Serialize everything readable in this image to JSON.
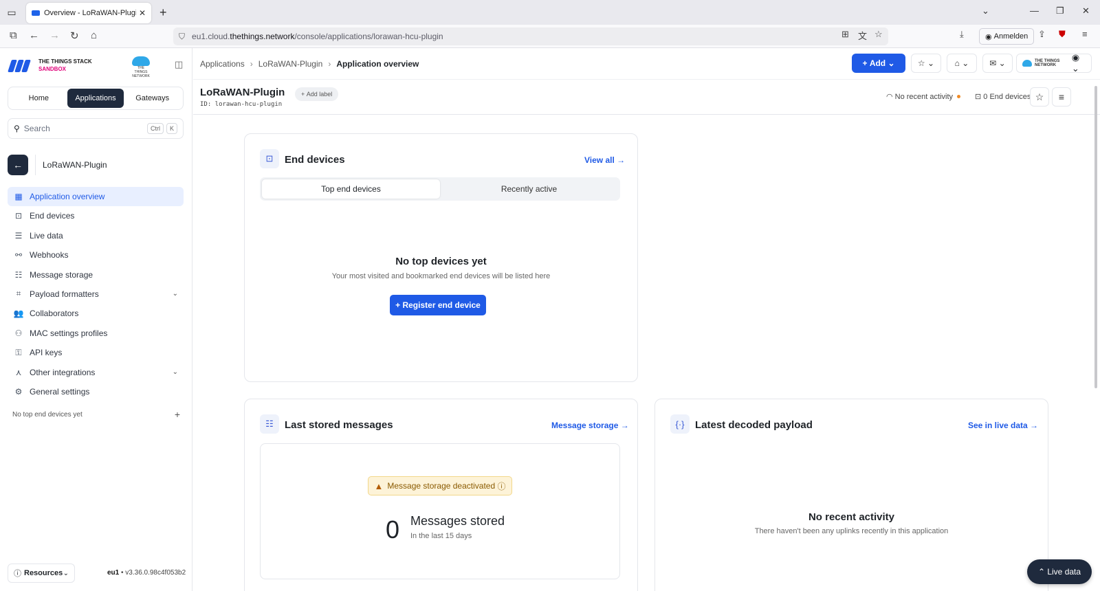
{
  "browser": {
    "tab_title": "Overview - LoRaWAN-Plugin - T",
    "url_prefix": "eu1.cloud.",
    "url_domain": "thethings.network",
    "url_path": "/console/applications/lorawan-hcu-plugin",
    "signin_label": "Anmelden"
  },
  "sidebar": {
    "brand_line1": "THE THINGS STACK",
    "brand_line2": "SANDBOX",
    "ttn_caption": "THE THINGS NETWORK",
    "nav": {
      "home": "Home",
      "applications": "Applications",
      "gateways": "Gateways"
    },
    "search": {
      "placeholder": "Search",
      "key1": "Ctrl",
      "key2": "K"
    },
    "app_name": "LoRaWAN-Plugin",
    "items": [
      {
        "label": "Application overview"
      },
      {
        "label": "End devices"
      },
      {
        "label": "Live data"
      },
      {
        "label": "Webhooks"
      },
      {
        "label": "Message storage"
      },
      {
        "label": "Payload formatters"
      },
      {
        "label": "Collaborators"
      },
      {
        "label": "MAC settings profiles"
      },
      {
        "label": "API keys"
      },
      {
        "label": "Other integrations"
      },
      {
        "label": "General settings"
      }
    ],
    "top_devices": "No top end devices yet",
    "resources_label": "Resources",
    "version_cluster": "eu1",
    "version": " • v3.36.0.98c4f053b2"
  },
  "topbar": {
    "breadcrumbs": [
      "Applications",
      "LoRaWAN-Plugin",
      "Application overview"
    ],
    "add_label": "Add",
    "ttn_chip": "THE THINGS NETWORK"
  },
  "app_header": {
    "title": "LoRaWAN-Plugin",
    "add_label": "Add label",
    "id": "ID: lorawan-hcu-plugin",
    "activity": "No recent activity",
    "device_count": "0 End devices"
  },
  "end_devices_card": {
    "title": "End devices",
    "link": "View all →",
    "tab_top": "Top end devices",
    "tab_recent": "Recently active",
    "empty_title": "No top devices yet",
    "empty_sub": "Your most visited and bookmarked end devices will be listed here",
    "register_label": "Register end device"
  },
  "stored_card": {
    "title": "Last stored messages",
    "link": "Message storage →",
    "warning": "Message storage deactivated",
    "count": "0",
    "count_label": "Messages stored",
    "count_sub": "In the last 15 days"
  },
  "payload_card": {
    "title": "Latest decoded payload",
    "link": "See in live data →",
    "empty_title": "No recent activity",
    "empty_sub": "There haven't been any uplinks recently in this application"
  },
  "live_data_button": "Live data"
}
